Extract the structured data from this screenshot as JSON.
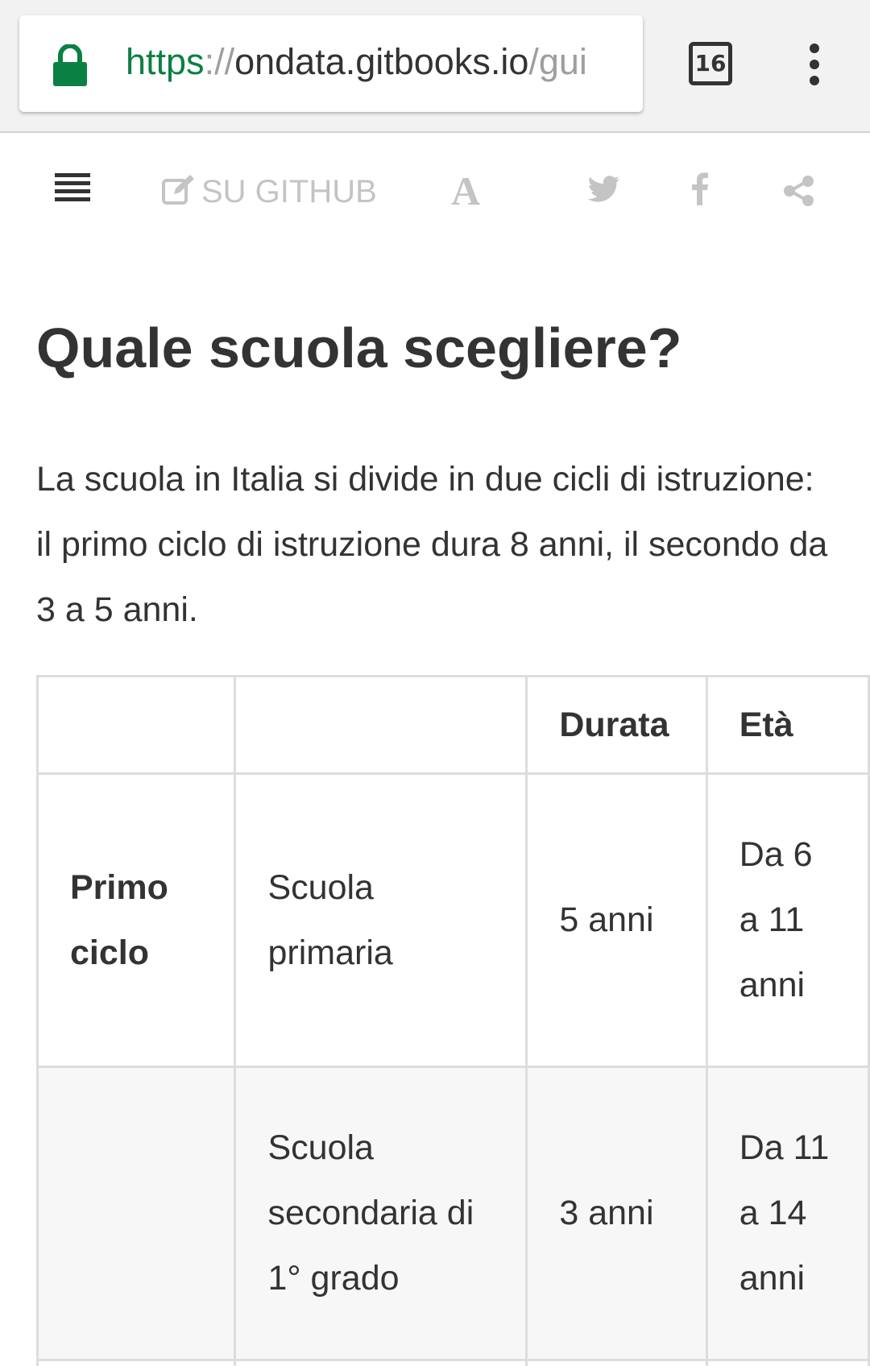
{
  "browser": {
    "url_scheme": "https",
    "url_separator": "://",
    "url_host": "ondata.gitbooks.io",
    "url_path": "/gui",
    "tab_count": "16"
  },
  "toolbar": {
    "edit_label": "SU GITHUB",
    "font_label": "A"
  },
  "article": {
    "title": "Quale scuola scegliere?",
    "intro": "La scuola in Italia si divide in due cicli di istruzione: il primo ciclo di istruzione dura 8 anni, il secondo da 3 a 5 anni."
  },
  "table": {
    "headers": [
      "",
      "",
      "Durata",
      "Età"
    ],
    "rows": [
      {
        "cycle": "Primo ciclo",
        "school": "Scuola primaria",
        "duration": "5 anni",
        "age": "Da 6 a 11 anni"
      },
      {
        "cycle": "",
        "school": "Scuola secondaria di 1° grado",
        "duration": "3 anni",
        "age": "Da 11 a 14 anni"
      }
    ]
  },
  "colors": {
    "lock_green": "#0b8043",
    "toolbar_icon_gray": "#c4c4c4",
    "text": "#333333",
    "table_border": "#dddddd",
    "row_stripe": "#f7f7f7"
  },
  "icons": [
    "lock-icon",
    "tab-switcher-icon",
    "overflow-menu-icon",
    "hamburger-menu-icon",
    "edit-icon",
    "font-settings-icon",
    "twitter-icon",
    "facebook-icon",
    "share-icon"
  ]
}
